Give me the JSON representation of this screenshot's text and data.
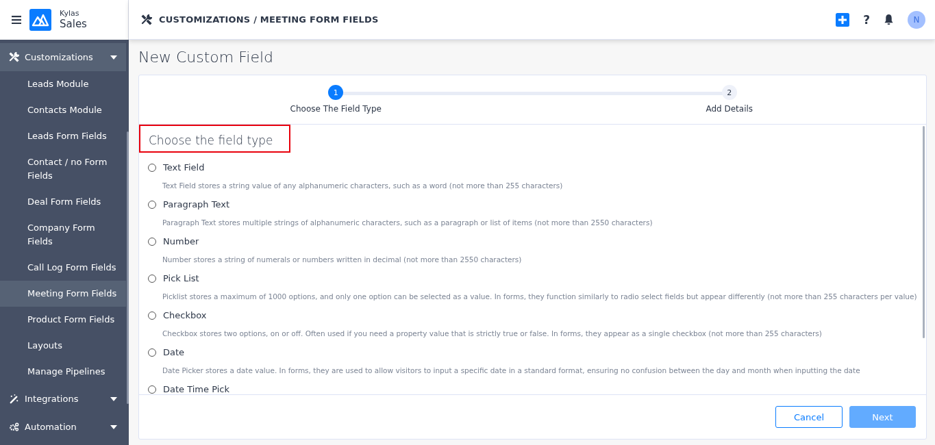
{
  "header": {
    "brand_top": "Kylas",
    "brand_bottom": "Sales",
    "breadcrumb": "CUSTOMIZATIONS / MEETING FORM FIELDS",
    "help": "?",
    "avatar": "N"
  },
  "sidebar": {
    "items": [
      {
        "label": "Customizations",
        "kind": "section",
        "expanded": true,
        "children": [
          {
            "label": "Leads Module",
            "selected": false
          },
          {
            "label": "Contacts Module",
            "selected": false
          },
          {
            "label": "Leads Form Fields",
            "selected": false
          },
          {
            "label": "Contact / no Form Fields",
            "selected": false
          },
          {
            "label": "Deal Form Fields",
            "selected": false
          },
          {
            "label": "Company Form Fields",
            "selected": false
          },
          {
            "label": "Call Log Form Fields",
            "selected": false
          },
          {
            "label": "Meeting Form Fields",
            "selected": true
          },
          {
            "label": "Product Form Fields",
            "selected": false
          },
          {
            "label": "Layouts",
            "selected": false
          },
          {
            "label": "Manage Pipelines",
            "selected": false
          }
        ]
      },
      {
        "label": "Integrations",
        "kind": "section",
        "expanded": false
      },
      {
        "label": "Automation",
        "kind": "section",
        "expanded": false
      }
    ]
  },
  "page_title": "New Custom Field",
  "steps": [
    {
      "number": "1",
      "label": "Choose The Field Type",
      "selected": true
    },
    {
      "number": "2",
      "label": "Add Details",
      "selected": false
    }
  ],
  "section_title": "Choose the field type",
  "options": [
    {
      "label": "Text Field",
      "description": "Text Field stores a string value of any alphanumeric characters, such as a word (not more than 255 characters)",
      "selected": false
    },
    {
      "label": "Paragraph Text",
      "description": "Paragraph Text stores multiple strings of alphanumeric characters, such as a paragraph or list of items (not more than 2550 characters)",
      "selected": false
    },
    {
      "label": "Number",
      "description": "Number stores a string of numerals or numbers written in decimal (not more than 2550 characters)",
      "selected": false
    },
    {
      "label": "Pick List",
      "description": "Picklist stores a maximum of 1000 options, and only one option can be selected as a value. In forms, they function similarly to radio select fields but appear differently (not more than 255 characters per value)",
      "selected": false
    },
    {
      "label": "Checkbox",
      "description": "Checkbox stores two options, on or off. Often used if you need a property value that is strictly true or false. In forms, they appear as a single checkbox (not more than 255 characters)",
      "selected": false
    },
    {
      "label": "Date",
      "description": "Date Picker stores a date value. In forms, they are used to allow visitors to input a specific date in a standard format, ensuring no confusion between the day and month when inputting the date",
      "selected": false
    },
    {
      "label": "Date Time Pick",
      "selected": false
    }
  ],
  "buttons": [
    {
      "label": "Cancel",
      "kind": "secondary",
      "disabled": false
    },
    {
      "label": "Next",
      "kind": "primary",
      "disabled": true
    }
  ]
}
